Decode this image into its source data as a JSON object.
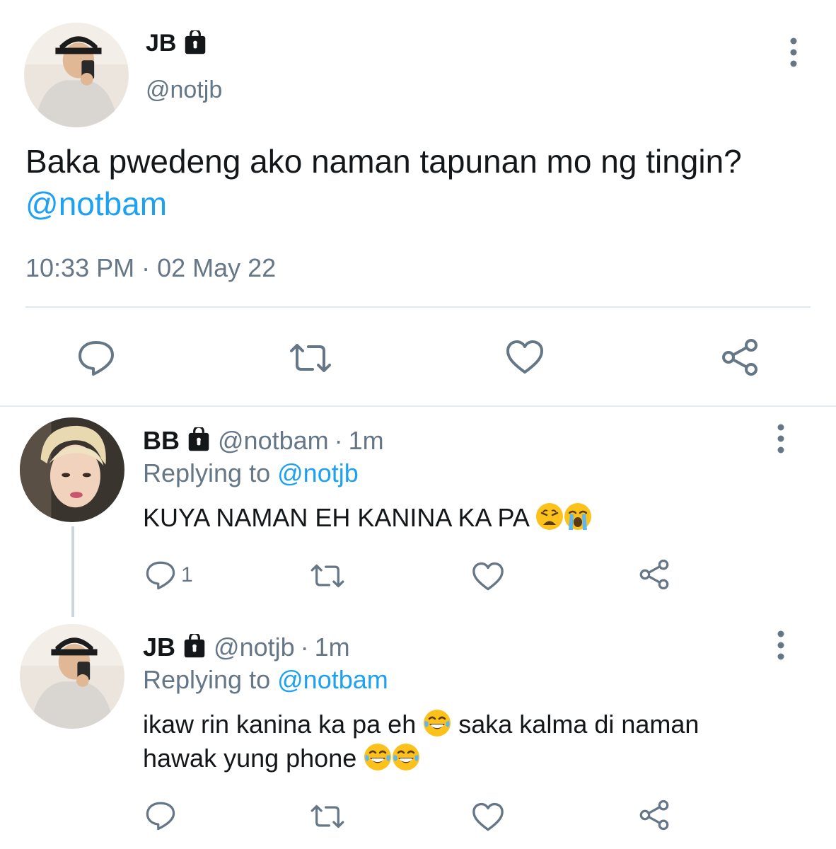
{
  "main_tweet": {
    "name": "JB",
    "handle": "@notjb",
    "text": "Baka pwedeng ako naman tapunan mo ng tingin?",
    "mention": "@notbam",
    "timestamp": "10:33 PM · 02 May 22",
    "avatar": "avatar-jb",
    "icons": [
      "lock-icon",
      "more-vertical-icon",
      "reply-icon",
      "retweet-icon",
      "like-icon",
      "share-icon"
    ]
  },
  "replies": [
    {
      "name": "BB",
      "handle": "@notbam",
      "time_sep": "·",
      "time": "1m",
      "replying_prefix": "Replying to",
      "replying_to": "@notjb",
      "text": "KUYA NAMAN EH KANINA KA PA",
      "emojis": [
        "weary-face-emoji",
        "loudly-crying-face-emoji"
      ],
      "reply_count": "1",
      "avatar": "avatar-bb"
    },
    {
      "name": "JB",
      "handle": "@notjb",
      "time_sep": "·",
      "time": "1m",
      "replying_prefix": "Replying to",
      "replying_to": "@notbam",
      "text_part1": "ikaw rin kanina ka pa eh",
      "text_part2": "saka kalma di naman",
      "text_part3": "hawak yung phone",
      "emojis": [
        "tears-of-joy-emoji",
        "tears-of-joy-emoji",
        "tears-of-joy-emoji"
      ],
      "reply_count": "",
      "avatar": "avatar-jb"
    }
  ],
  "colors": {
    "accent": "#1da1f2",
    "secondary_text": "#657786",
    "primary_text": "#14171a",
    "divider": "#e1e8ed",
    "thread_line": "#ccd6dd"
  }
}
